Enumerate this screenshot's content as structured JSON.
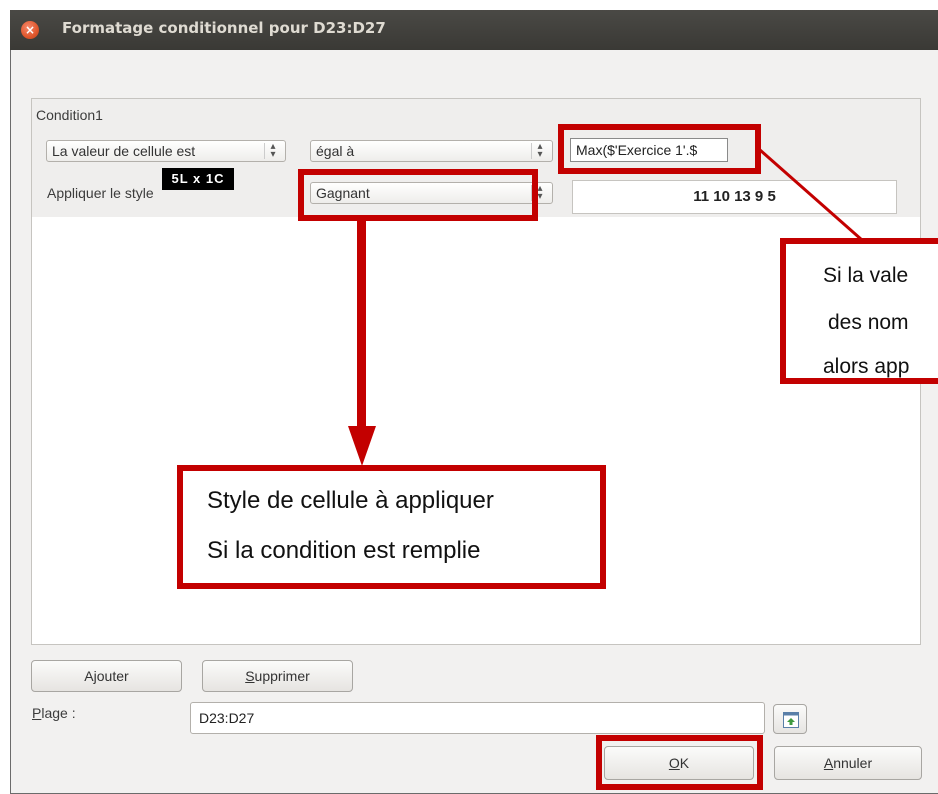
{
  "window": {
    "title": "Formatage conditionnel pour D23:D27",
    "close_glyph": "×"
  },
  "condition": {
    "label": "Condition1",
    "type_combo": "La valeur de cellule est",
    "operator_combo": "égal à",
    "formula_value": "Max($'Exercice 1'.$",
    "apply_style_label": "Appliquer le style",
    "style_combo": "Gagnant",
    "preview_text": "11 10 13 9 5"
  },
  "tooltip": "5L x 1C",
  "annotations": {
    "right_callout": [
      "Si la vale",
      "des nom",
      "alors app"
    ],
    "bottom_callout": [
      "Style de cellule à appliquer",
      "Si la condition est remplie"
    ],
    "color": "#c30000"
  },
  "buttons": {
    "add": "Ajouter",
    "add_mnemonic": "j",
    "delete": "Supprimer",
    "delete_mnemonic": "S",
    "ok": "OK",
    "ok_mnemonic": "O",
    "cancel": "Annuler",
    "cancel_mnemonic": "A"
  },
  "range": {
    "label": "Plage :",
    "label_mnemonic": "P",
    "value": "D23:D27",
    "shrink_icon": "shrink-selection-icon"
  },
  "colors": {
    "titlebar": "#3c3b37",
    "dialog_bg": "#f2f1f0",
    "close_button": "#e0572c"
  }
}
